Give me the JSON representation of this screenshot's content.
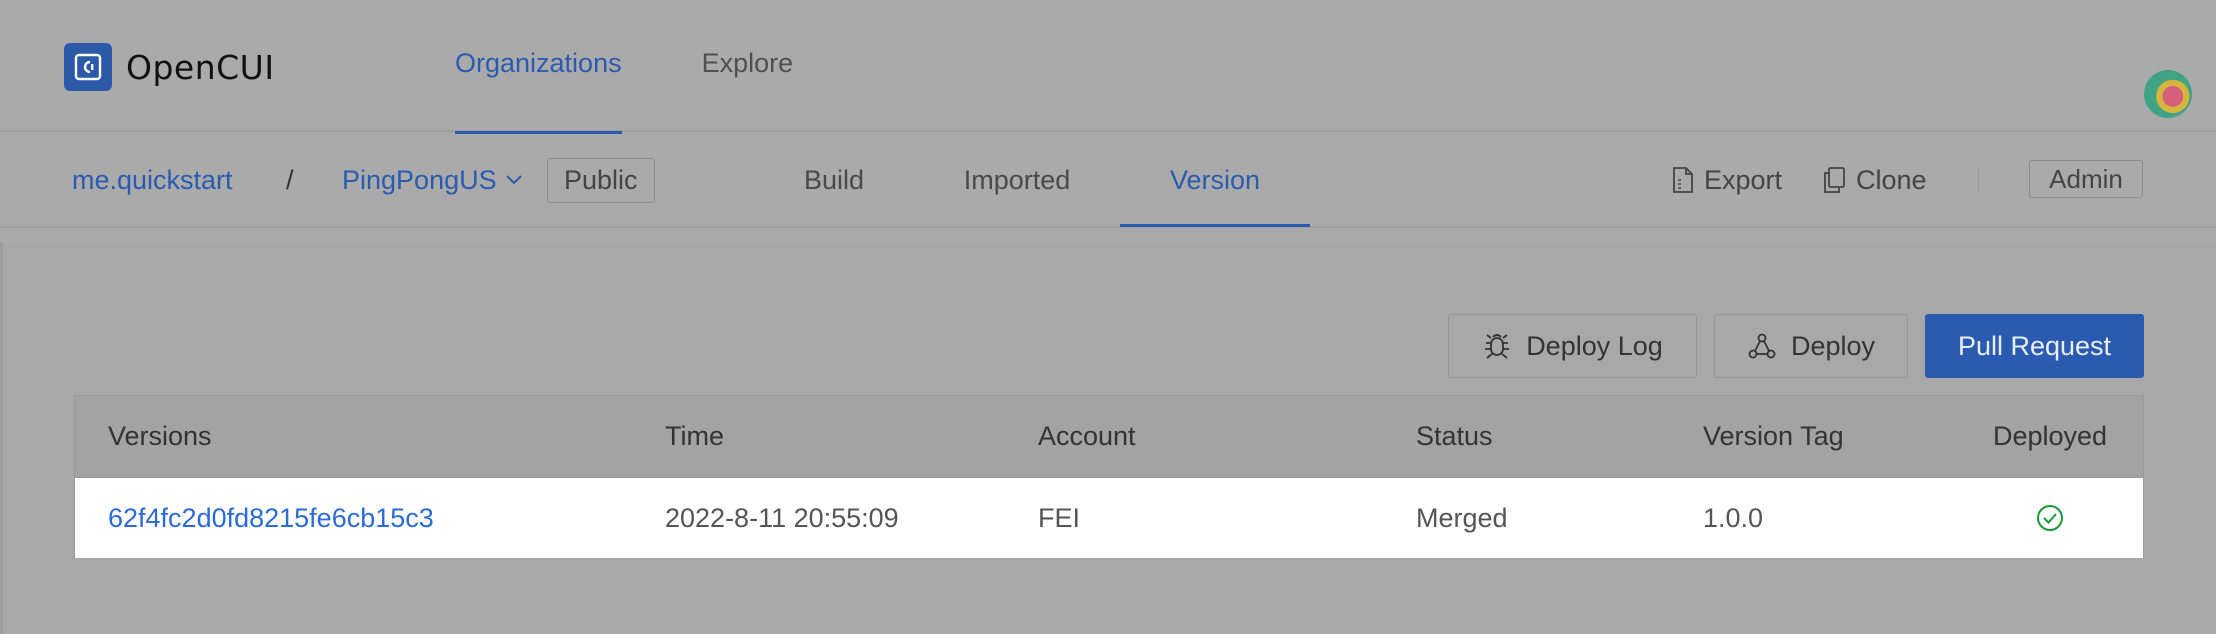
{
  "app": {
    "name": "OpenCUI"
  },
  "topnav": {
    "items": [
      {
        "label": "Organizations",
        "active": true
      },
      {
        "label": "Explore",
        "active": false
      }
    ]
  },
  "breadcrumb": {
    "org": "me.quickstart",
    "separator": "/",
    "project": "PingPongUS",
    "visibility": "Public"
  },
  "tabs": [
    {
      "label": "Build"
    },
    {
      "label": "Imported"
    },
    {
      "label": "Version",
      "active": true
    }
  ],
  "actions": {
    "export": "Export",
    "clone": "Clone",
    "admin": "Admin"
  },
  "toolbar": {
    "deploy_log": "Deploy Log",
    "deploy": "Deploy",
    "pull_request": "Pull Request"
  },
  "table": {
    "columns": [
      "Versions",
      "Time",
      "Account",
      "Status",
      "Version Tag",
      "Deployed"
    ],
    "rows": [
      {
        "version": "62f4fc2d0fd8215fe6cb15c3",
        "time": "2022-8-11 20:55:09",
        "account": "FEI",
        "status": "Merged",
        "tag": "1.0.0",
        "deployed": true
      }
    ]
  },
  "colors": {
    "accent": "#2b5bb0",
    "link": "#2b6bd6",
    "success": "#1a9a3a"
  }
}
